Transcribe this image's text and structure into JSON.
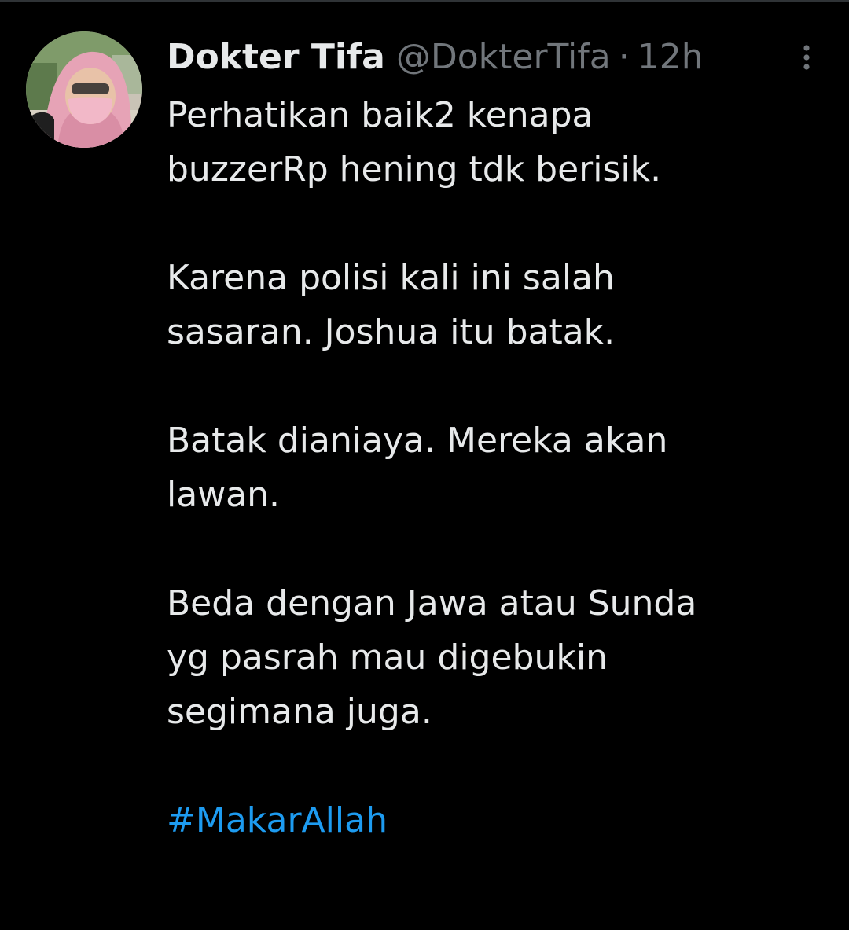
{
  "tweet": {
    "author": {
      "display_name": "Dokter Tifa",
      "handle": "@DokterTifa"
    },
    "separator": "·",
    "timestamp": "12h",
    "body": [
      {
        "lines": [
          "Perhatikan baik2 kenapa",
          "buzzerRp hening tdk berisik."
        ]
      },
      {
        "lines": [
          "Karena polisi kali ini salah",
          "sasaran. Joshua itu batak."
        ]
      },
      {
        "lines": [
          "Batak dianiaya. Mereka akan",
          "lawan."
        ]
      },
      {
        "lines": [
          "Beda dengan Jawa atau Sunda",
          "yg pasrah mau digebukin",
          "segimana juga."
        ]
      }
    ],
    "hashtag": "#MakarAllah"
  },
  "colors": {
    "background": "#000000",
    "primary_text": "#e7e9ea",
    "secondary_text": "#71767b",
    "link": "#1d9bf0"
  },
  "icons": {
    "more": "more-vertical-icon"
  }
}
